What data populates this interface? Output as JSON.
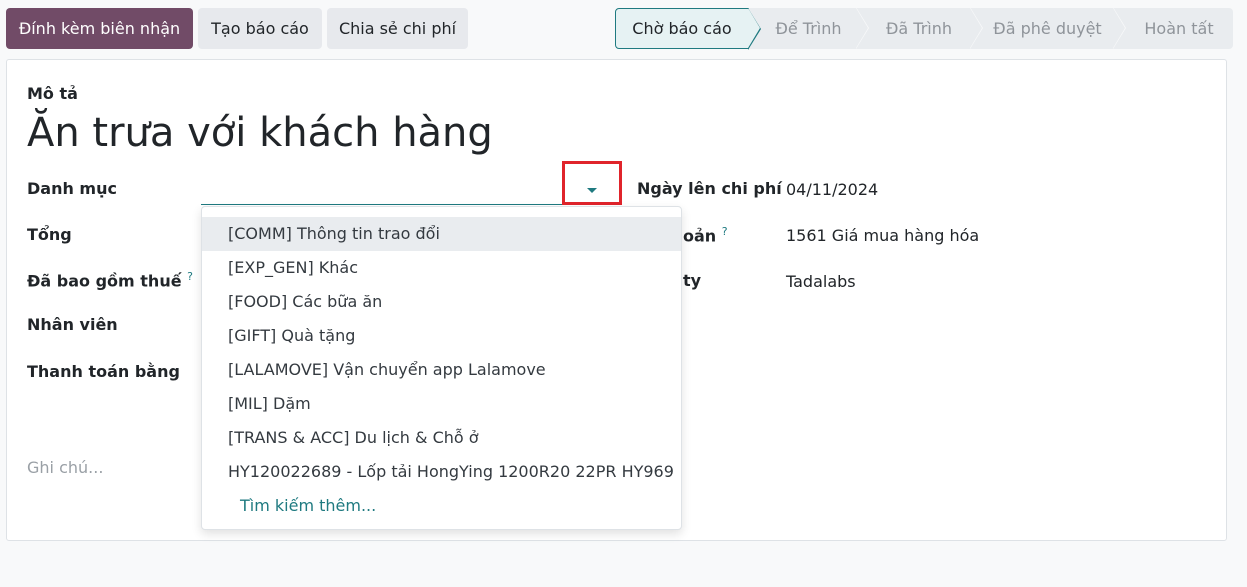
{
  "toolbar": {
    "attach_receipt": "Đính kèm biên nhận",
    "create_report": "Tạo báo cáo",
    "split_expense": "Chia sẻ chi phí"
  },
  "stages": [
    "Chờ báo cáo",
    "Để Trình",
    "Đã Trình",
    "Đã phê duyệt",
    "Hoàn tất"
  ],
  "active_stage": "Chờ báo cáo",
  "form": {
    "description_label": "Mô tả",
    "title": "Ăn trưa với khách hàng",
    "category_label": "Danh mục",
    "category_value": "",
    "total_label": "Tổng",
    "tax_label": "Đã bao gồm thuế",
    "employee_label": "Nhân viên",
    "paid_by_label": "Thanh toán bằng",
    "expense_date_label": "Ngày lên chi phí",
    "expense_date_value": "04/11/2024",
    "account_label_partial": "oản",
    "account_value": "1561 Giá mua hàng hóa",
    "company_label_partial": "ty",
    "company_value": "Tadalabs",
    "notes_placeholder": "Ghi chú...",
    "help_mark": "?"
  },
  "dropdown": {
    "items": [
      "[COMM] Thông tin trao đổi",
      "[EXP_GEN] Khác",
      "[FOOD] Các bữa ăn",
      "[GIFT] Quà tặng",
      "[LALAMOVE] Vận chuyển app Lalamove",
      "[MIL] Dặm",
      "[TRANS & ACC] Du lịch & Chỗ ở",
      "HY120022689 - Lốp tải HongYing 1200R20 22PR HY969"
    ],
    "search_more": "Tìm kiếm thêm..."
  },
  "colors": {
    "primary": "#714b67",
    "accent": "#1f7a80",
    "highlight": "#e0242b"
  }
}
